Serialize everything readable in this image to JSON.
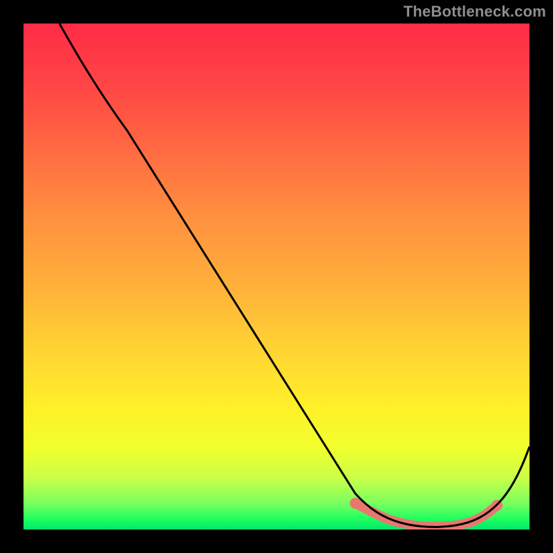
{
  "attribution": "TheBottleneck.com",
  "chart_data": {
    "type": "line",
    "title": "",
    "xlabel": "",
    "ylabel": "",
    "xlim": [
      0,
      100
    ],
    "ylim": [
      0,
      100
    ],
    "grid": false,
    "legend": false,
    "series": [
      {
        "name": "main-curve",
        "color": "#000000",
        "x": [
          7,
          13,
          20,
          30,
          40,
          50,
          60,
          66,
          70,
          73,
          76,
          78,
          80,
          82,
          84,
          86,
          88,
          90,
          93,
          96,
          100
        ],
        "values": [
          100,
          94,
          86,
          74,
          61,
          48,
          35,
          27,
          21,
          16,
          11,
          7,
          4,
          2,
          1,
          1,
          2,
          3,
          6,
          11,
          22
        ]
      },
      {
        "name": "bottom-band",
        "color": "#e9776f",
        "x": [
          66,
          70,
          73,
          76,
          78,
          80,
          82,
          84,
          86,
          88,
          90,
          93
        ],
        "values": [
          5,
          4,
          3,
          2,
          2,
          1,
          1,
          1,
          1,
          1,
          2,
          3
        ]
      }
    ],
    "annotations": []
  }
}
